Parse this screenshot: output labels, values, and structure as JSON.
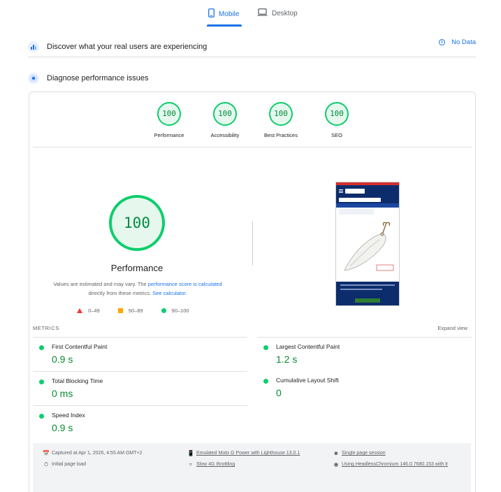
{
  "tabs": [
    {
      "label": "Mobile",
      "active": true
    },
    {
      "label": "Desktop",
      "active": false
    }
  ],
  "crux": {
    "title": "Discover what your real users are experiencing",
    "no_data": "No Data"
  },
  "diagnose": {
    "title": "Diagnose performance issues"
  },
  "category_scores": [
    {
      "score": "100",
      "label": "Performance"
    },
    {
      "score": "100",
      "label": "Accessibility"
    },
    {
      "score": "100",
      "label": "Best Practices"
    },
    {
      "score": "100",
      "label": "SEO"
    }
  ],
  "performance": {
    "score": "100",
    "label": "Performance",
    "note_prefix": "Values are estimated and may vary. The ",
    "note_link1": "performance score is calculated",
    "note_middle": " directly from these metrics. ",
    "note_link2": "See calculator.",
    "legend": [
      {
        "range": "0–49",
        "color": "#ff3333"
      },
      {
        "range": "50–89",
        "color": "#ffa400"
      },
      {
        "range": "90–100",
        "color": "#0cce6b"
      }
    ]
  },
  "metrics": {
    "heading": "METRICS",
    "expand_label": "Expand view",
    "items": [
      {
        "name": "First Contentful Paint",
        "value": "0.9 s"
      },
      {
        "name": "Largest Contentful Paint",
        "value": "1.2 s"
      },
      {
        "name": "Total Blocking Time",
        "value": "0 ms"
      },
      {
        "name": "Cumulative Layout Shift",
        "value": "0"
      },
      {
        "name": "Speed Index",
        "value": "0.9 s"
      }
    ]
  },
  "runtime": {
    "captured": "Captured at Apr 1, 2026, 4:55 AM GMT+2",
    "page_load": "Initial page load",
    "device": "Emulated Moto G Power with Lighthouse 13.0.1",
    "throttling": "Slow 4G throttling",
    "session": "Single page session",
    "browser": "Using HeadlessChromium 146.0.7680.153 with lr"
  },
  "colors": {
    "accent": "#1a73e8",
    "pass": "#0cce6b",
    "pass_text": "#008a3e"
  }
}
